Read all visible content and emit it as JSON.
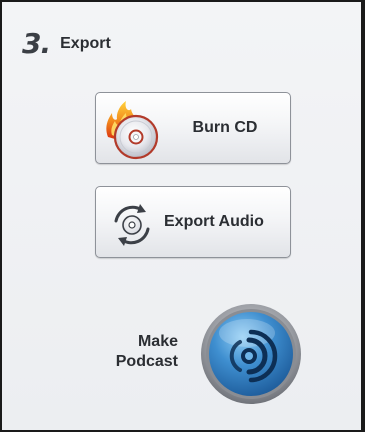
{
  "section": {
    "step_number": "3.",
    "title": "Export"
  },
  "buttons": {
    "burn_cd": "Burn CD",
    "export_audio": "Export Audio"
  },
  "podcast": {
    "line1": "Make",
    "line2": "Podcast"
  },
  "icons": {
    "burn": "flaming-cd-icon",
    "export": "circular-arrows-icon",
    "podcast": "podcast-broadcast-icon"
  },
  "colors": {
    "panel_bg": "#eceef1",
    "text": "#2b2e33",
    "podcast_blue": "#3f8fd0",
    "flame_orange": "#f2891d"
  }
}
